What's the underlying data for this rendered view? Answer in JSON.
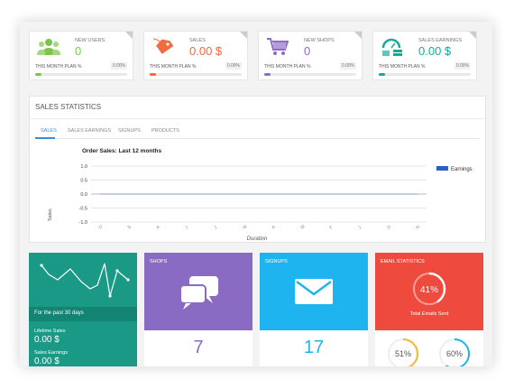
{
  "stats": [
    {
      "label": "NEW USERS",
      "value": "0",
      "plan_label": "THIS MONTH PLAN %",
      "pct": "0.00%",
      "color": "#7cc44d",
      "icon": "users-icon"
    },
    {
      "label": "SALES",
      "value": "0.00 $",
      "plan_label": "THIS MONTH PLAN %",
      "pct": "0.00%",
      "color": "#f26a3d",
      "icon": "price-tag-icon"
    },
    {
      "label": "NEW SHOPS",
      "value": "0",
      "plan_label": "THIS MONTH PLAN %",
      "pct": "0.00%",
      "color": "#8e6bc7",
      "icon": "shopping-cart-icon"
    },
    {
      "label": "SALES EARNINGS",
      "value": "0.00 $",
      "plan_label": "THIS MONTH PLAN %",
      "pct": "0.00%",
      "color": "#18a89b",
      "icon": "money-gauge-icon"
    }
  ],
  "sales_statistics": {
    "title": "SALES STATISTICS",
    "tabs": [
      "SALES",
      "SALES EARNINGS",
      "SIGNUPS",
      "PRODUCTS"
    ],
    "active_tab": "SALES"
  },
  "chart_data": {
    "type": "line",
    "title": "Order Sales: Last 12 months",
    "xlabel": "Duration",
    "ylabel": "Sales",
    "ylim": [
      -1.0,
      1.0
    ],
    "yticks": [
      "1.0",
      "0.5",
      "0.0",
      "-0.5",
      "-1.0"
    ],
    "categories": [
      "O",
      "S",
      "A",
      "J",
      "J",
      "M",
      "A",
      "M",
      "F",
      "J",
      "D",
      "N"
    ],
    "series": [
      {
        "name": "Earnings",
        "values": [
          0,
          0,
          0,
          0,
          0,
          0,
          0,
          0,
          0,
          0,
          0,
          0
        ],
        "color": "#2f5fc4"
      }
    ],
    "legend": "top-right",
    "grid": true
  },
  "cards": {
    "past": {
      "caption": "For the past 30 days",
      "lifetime_label": "Lifetime Sales",
      "lifetime_value": "0.00 $",
      "earnings_label": "Sales Earnings",
      "earnings_value": "0.00 $",
      "color": "#1a9a86"
    },
    "shops": {
      "title": "SHOPS",
      "value": "7",
      "color": "#8a6bc4",
      "icon": "chat-bubbles-icon"
    },
    "signups": {
      "title": "SIGNUPS",
      "value": "17",
      "color": "#1eb4ef",
      "icon": "envelope-icon"
    },
    "email": {
      "title": "EMAIL STATISTICS",
      "pct": "41%",
      "pct_label": "Total Emails Sent",
      "rate1": "51%",
      "rate2": "60%",
      "color": "#ef4a3e"
    }
  }
}
